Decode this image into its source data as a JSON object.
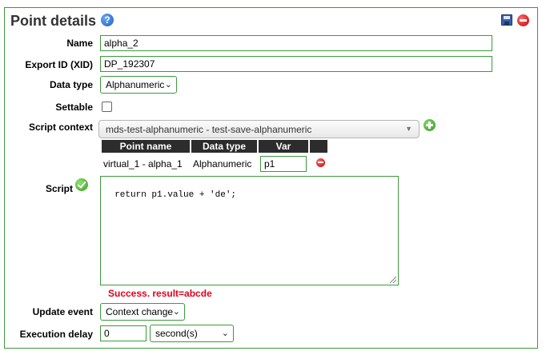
{
  "panel": {
    "title": "Point details",
    "help_icon": "help-icon",
    "save_icon": "save-icon",
    "delete_icon": "delete-icon"
  },
  "fields": {
    "name_label": "Name",
    "name_value": "alpha_2",
    "xid_label": "Export ID (XID)",
    "xid_value": "DP_192307",
    "data_type_label": "Data type",
    "data_type_value": "Alphanumeric",
    "settable_label": "Settable",
    "settable_checked": false,
    "script_context_label": "Script context",
    "script_context_value": "mds-test-alphanumeric - test-save-alphanumeric",
    "script_label": "Script",
    "script_value": "return p1.value + 'de';",
    "result_text": "Success. result=abcde",
    "update_event_label": "Update event",
    "update_event_value": "Context change",
    "execution_delay_label": "Execution delay",
    "execution_delay_value": "0",
    "execution_delay_unit": "second(s)"
  },
  "context_table": {
    "headers": [
      "Point name",
      "Data type",
      "Var"
    ],
    "rows": [
      {
        "point_name": "virtual_1 - alpha_1",
        "data_type": "Alphanumeric",
        "var": "p1"
      }
    ]
  },
  "colors": {
    "border_green": "#3c9a3c",
    "error_red": "#e0001b",
    "header_dark": "#2c2c2c"
  }
}
